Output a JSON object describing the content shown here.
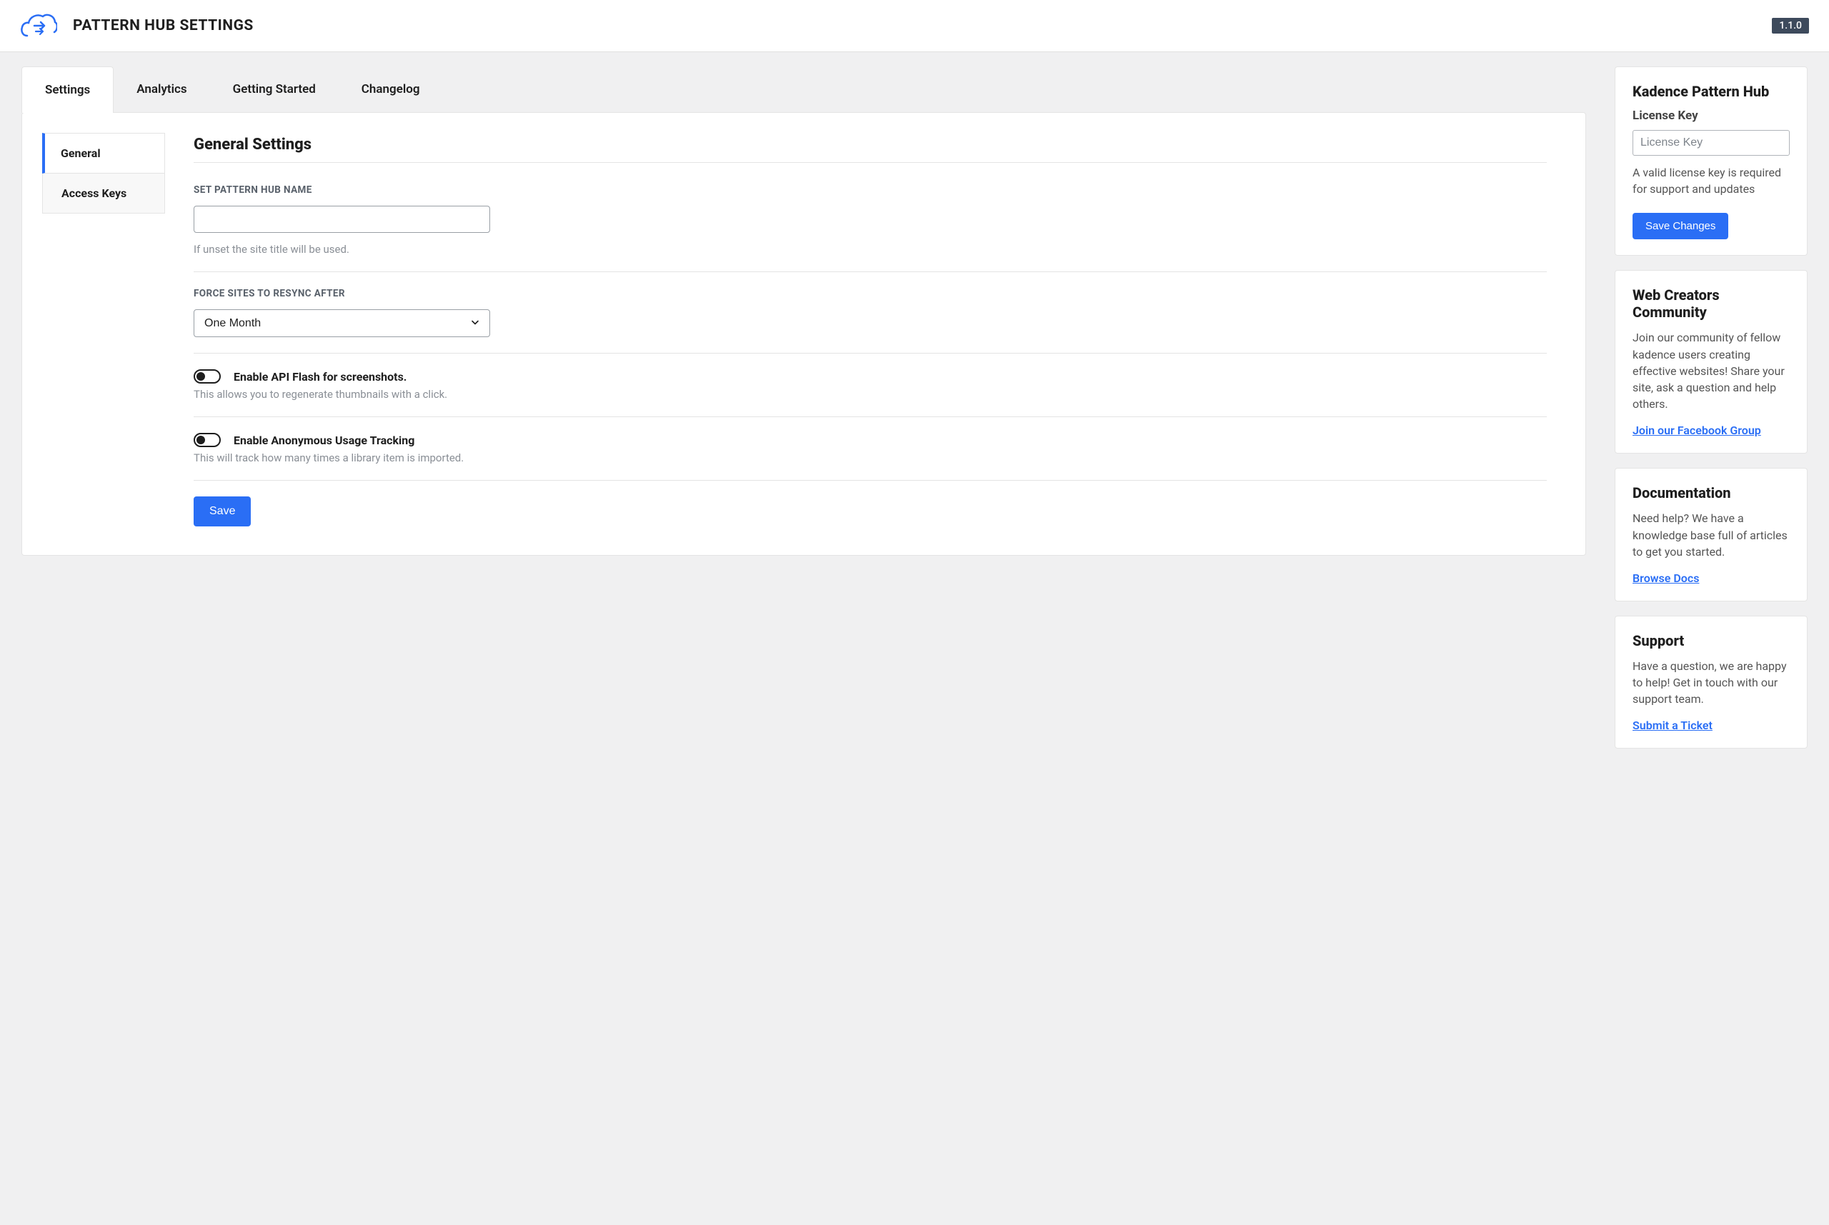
{
  "header": {
    "title": "PATTERN HUB SETTINGS",
    "version": "1.1.0"
  },
  "tabs": [
    {
      "label": "Settings",
      "active": true
    },
    {
      "label": "Analytics",
      "active": false
    },
    {
      "label": "Getting Started",
      "active": false
    },
    {
      "label": "Changelog",
      "active": false
    }
  ],
  "sideNav": [
    {
      "label": "General",
      "active": true
    },
    {
      "label": "Access Keys",
      "active": false
    }
  ],
  "content": {
    "heading": "General Settings",
    "hubName": {
      "label": "SET PATTERN HUB NAME",
      "value": "",
      "help": "If unset the site title will be used."
    },
    "resync": {
      "label": "FORCE SITES TO RESYNC AFTER",
      "value": "One Month"
    },
    "apiFlash": {
      "label": "Enable API Flash for screenshots.",
      "help": "This allows you to regenerate thumbnails with a click.",
      "checked": false
    },
    "tracking": {
      "label": "Enable Anonymous Usage Tracking",
      "help": "This will track how many times a library item is imported.",
      "checked": false
    },
    "saveLabel": "Save"
  },
  "sidebar": {
    "license": {
      "title": "Kadence Pattern Hub",
      "label": "License Key",
      "placeholder": "License Key",
      "help": "A valid license key is required for support and updates",
      "button": "Save Changes"
    },
    "community": {
      "title": "Web Creators Community",
      "text": "Join our community of fellow kadence users creating effective websites! Share your site, ask a question and help others.",
      "link": "Join our Facebook Group"
    },
    "docs": {
      "title": "Documentation",
      "text": "Need help? We have a knowledge base full of articles to get you started.",
      "link": "Browse Docs"
    },
    "support": {
      "title": "Support",
      "text": "Have a question, we are happy to help! Get in touch with our support team.",
      "link": "Submit a Ticket"
    }
  }
}
